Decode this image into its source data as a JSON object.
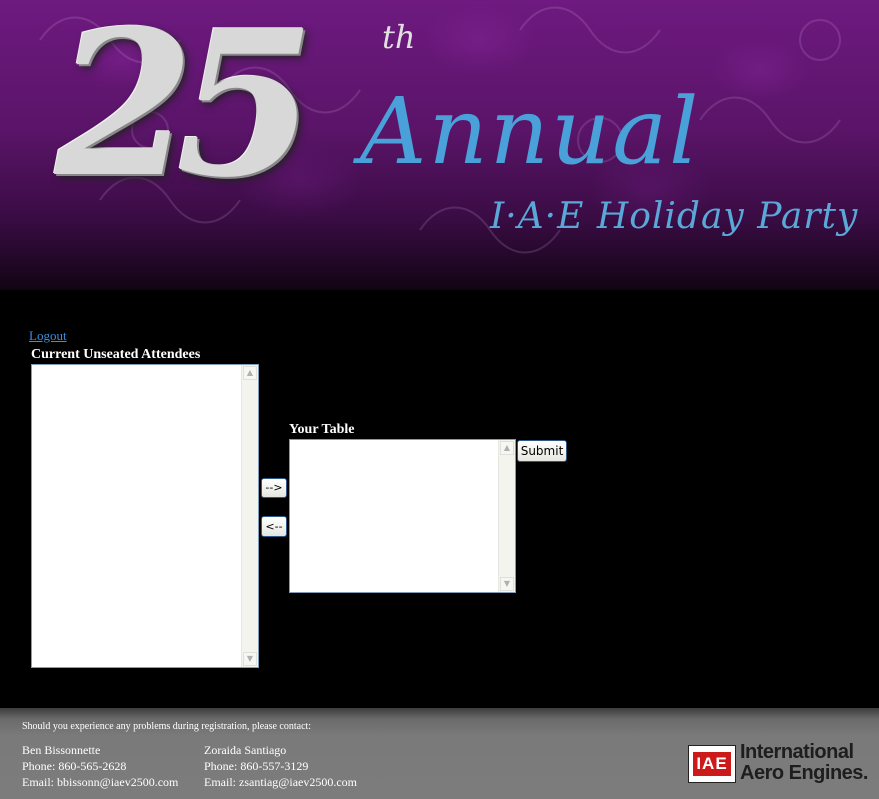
{
  "header": {
    "big_number": "25",
    "superscript": "th",
    "annual": "Annual",
    "subtitle": "I·A·E Holiday Party"
  },
  "nav": {
    "logout": "Logout"
  },
  "attendees": {
    "label": "Current Unseated Attendees",
    "items": []
  },
  "your_table": {
    "label": "Your Table",
    "items": [],
    "submit_label": "Submit"
  },
  "move_buttons": {
    "right": "-->",
    "left": "<--"
  },
  "scroll_icons": {
    "up": "▲",
    "down": "▼"
  },
  "footer": {
    "note": "Should you experience any problems during registration, please contact:",
    "contact1": {
      "name": "Ben Bissonnette",
      "phone": "Phone: 860-565-2628",
      "email": "Email: bbissonn@iaev2500.com"
    },
    "contact2": {
      "name": "Zoraida Santiago",
      "phone": "Phone: 860-557-3129",
      "email": "Email: zsantiag@iaev2500.com"
    },
    "logo_mark": "IAE",
    "logo_line1": "International",
    "logo_line2": "Aero Engines."
  },
  "colors": {
    "link": "#3a8fe0",
    "banner": "#5a1468",
    "logo_red": "#cc1a1a"
  }
}
